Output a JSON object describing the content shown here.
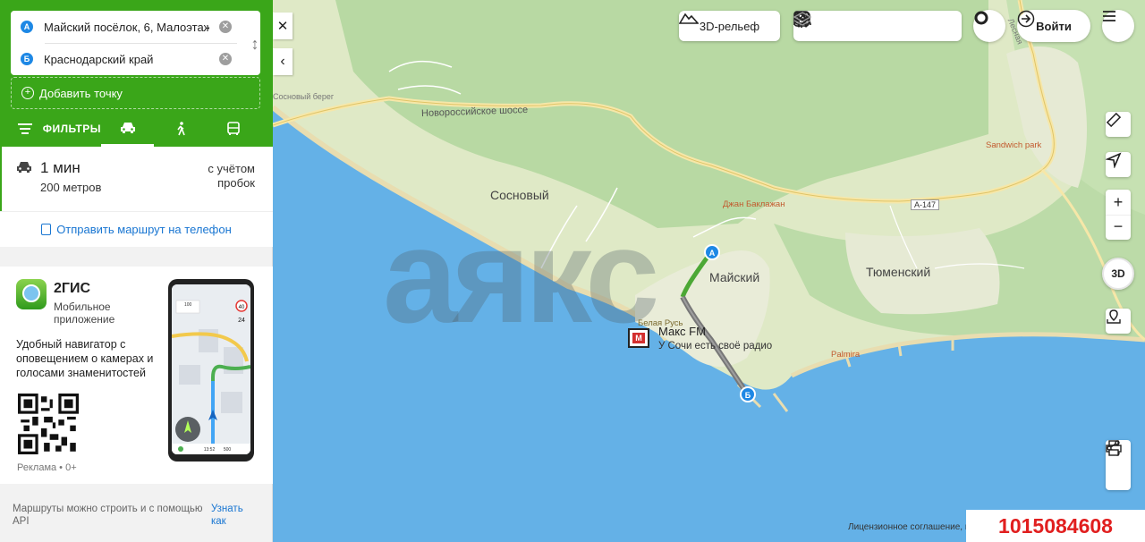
{
  "route": {
    "from": "Майский посёлок, 6, Малоэтажн",
    "to": "Краснодарский край",
    "from_pin": "А",
    "to_pin": "Б",
    "add_point": "Добавить точку"
  },
  "tabs": {
    "filters": "ФИЛЬТРЫ",
    "items": [
      "car-icon",
      "walk-icon",
      "bus-icon"
    ]
  },
  "result": {
    "time": "1 мин",
    "distance": "200 метров",
    "traffic": "с учётом пробок"
  },
  "send_to_phone": "Отправить маршрут на телефон",
  "ad": {
    "brand": "2ГИС",
    "subtitle": "Мобильное приложение",
    "description": "Удобный навигатор с оповещением о камерах и голосами знаменитостей",
    "footer": "Реклама • 0+",
    "phone_speed": "40",
    "phone_num": "24",
    "phone_dist": "100",
    "phone_time": "13:52",
    "phone_km": "500"
  },
  "api_note": "Маршруты можно строить и с помощью API",
  "api_link": "Узнать как",
  "toolbar": {
    "relief": "3D-рельеф",
    "login": "Войти",
    "btn3d": "3D"
  },
  "map_labels": {
    "coast": "Сосновый берег",
    "highway": "Новороссийское шоссе",
    "sosnovy": "Сосновый",
    "maysky": "Майский",
    "tyumensky": "Тюменский",
    "sandwich": "Sandwich park",
    "djan": "Джан Баклажан",
    "a147": "А-147",
    "belaya": "Белая Русь",
    "palmira": "Palmira",
    "street": "Лесная"
  },
  "radio": {
    "name": "Макс FM",
    "slogan": "У Сочи есть своё радио",
    "logo_letter": "М"
  },
  "license": "Лицензионное соглашение, г",
  "listing_id": "1015084608",
  "watermark": "аякс",
  "colors": {
    "brand_green": "#3aa619",
    "sea": "#64b1e7",
    "land": "#dfe9c6",
    "forest": "#b8d9a3",
    "route": "#6b6b6b",
    "link": "#1976d2",
    "id_red": "#e11f1f"
  }
}
